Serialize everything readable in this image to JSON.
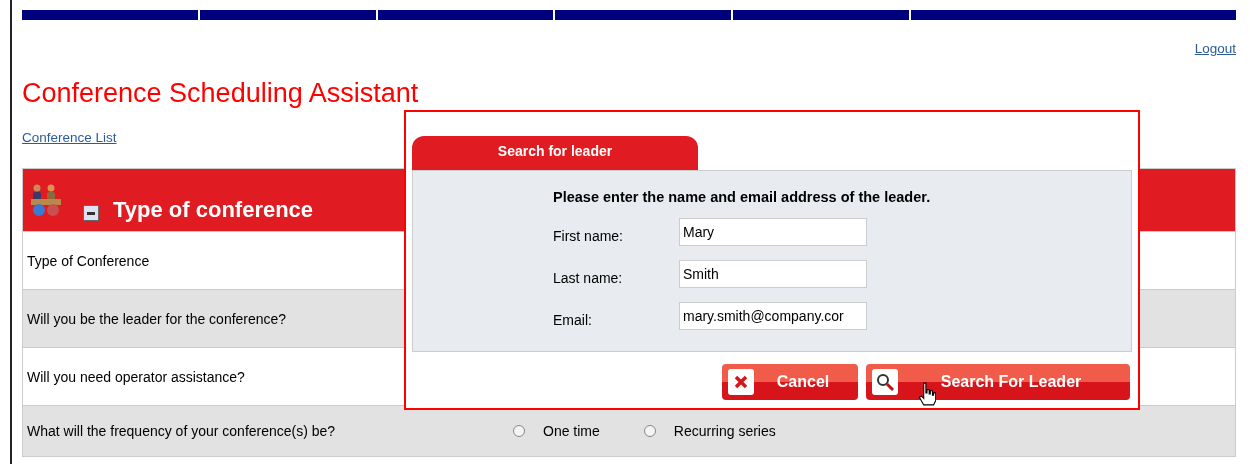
{
  "logout": "Logout",
  "title": "Conference Scheduling Assistant",
  "breadcrumb_link": "Conference List",
  "section": {
    "title": "Type of conference",
    "expanded": true
  },
  "rows": [
    {
      "label": "Type of Conference"
    },
    {
      "label": "Will you be the leader for the conference?"
    },
    {
      "label": "Will you need operator assistance?"
    },
    {
      "label": "What will the frequency of your conference(s) be?",
      "options": [
        {
          "label": "One time",
          "selected": false
        },
        {
          "label": "Recurring series",
          "selected": false
        }
      ]
    }
  ],
  "dialog": {
    "tab": "Search for leader",
    "instruction": "Please enter the name and email address of the leader.",
    "fields": [
      {
        "label": "First name:",
        "value": "Mary"
      },
      {
        "label": "Last name:",
        "value": "Smith"
      },
      {
        "label": "Email:",
        "value": "mary.smith@company.cor"
      }
    ],
    "buttons": [
      {
        "kind": "cancel",
        "label": "Cancel"
      },
      {
        "kind": "search",
        "label": "Search For Leader"
      }
    ]
  }
}
